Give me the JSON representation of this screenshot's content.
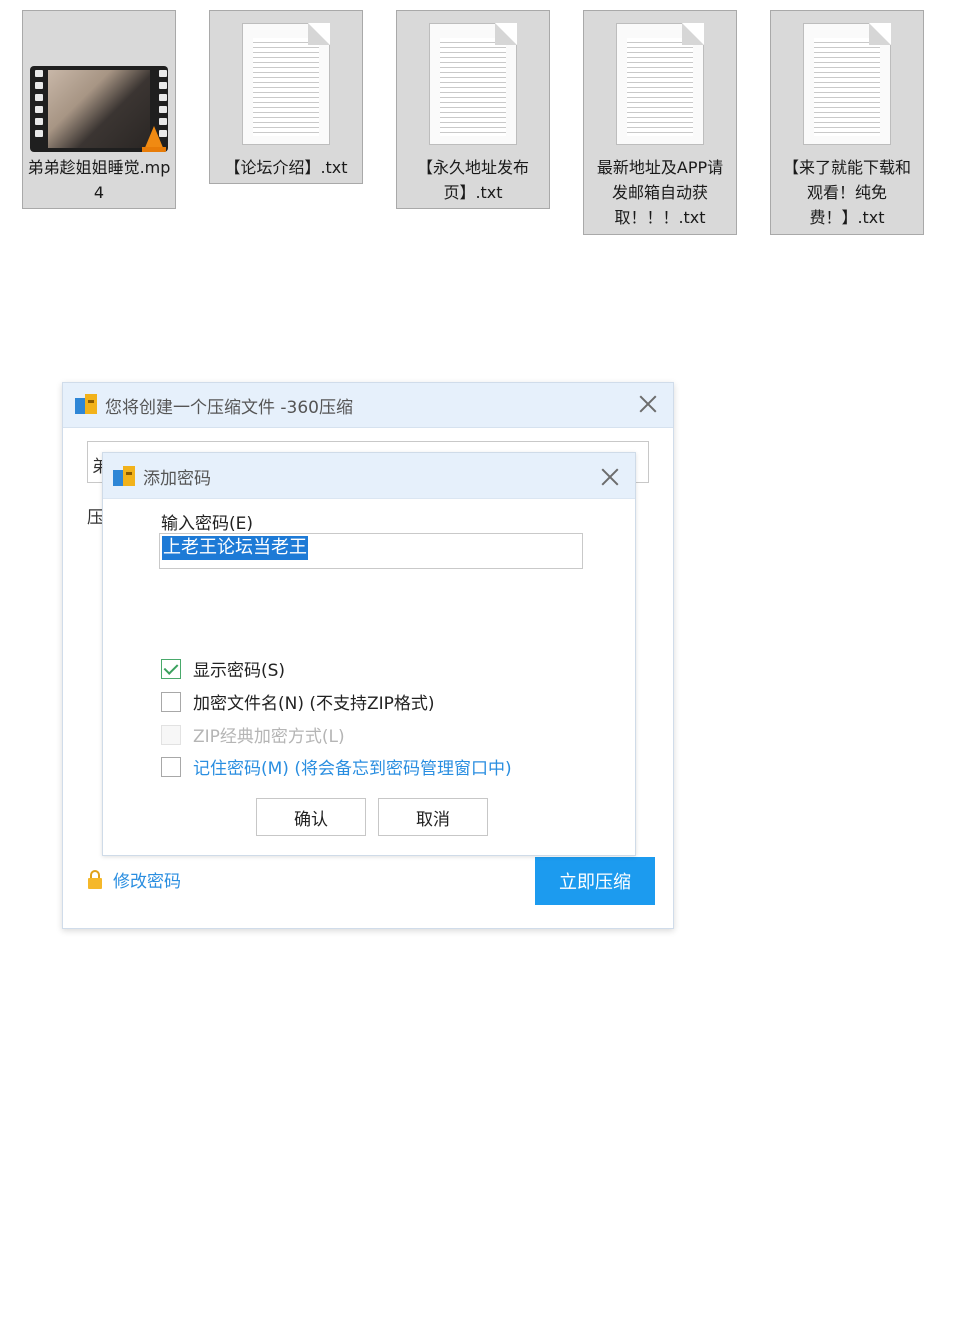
{
  "files": [
    {
      "label": "弟弟趁姐姐睡觉.mp4",
      "icon": "video-file-icon"
    },
    {
      "label": "【论坛介绍】.txt",
      "icon": "text-file-icon"
    },
    {
      "label": "【永久地址发布页】.txt",
      "icon": "text-file-icon"
    },
    {
      "label": "最新地址及APP请发邮箱自动获取！！！.txt",
      "icon": "text-file-icon"
    },
    {
      "label": "【来了就能下载和观看！纯免费！】.txt",
      "icon": "text-file-icon"
    }
  ],
  "compress_dialog": {
    "title": "您将创建一个压缩文件 -360压缩",
    "path_field_partial": "弟",
    "compress_format_partial": "压",
    "change_password_label": "修改密码",
    "compress_now_label": "立即压缩"
  },
  "password_dialog": {
    "title": "添加密码",
    "input_label": "输入密码(E)",
    "password_value": "上老王论坛当老王",
    "options": [
      {
        "label": "显示密码(S)",
        "checked": true,
        "disabled": false
      },
      {
        "label": "加密文件名(N) (不支持ZIP格式)",
        "checked": false,
        "disabled": false
      },
      {
        "label": "ZIP经典加密方式(L)",
        "checked": false,
        "disabled": true
      },
      {
        "label": "记住密码(M) (将会备忘到密码管理窗口中)",
        "checked": false,
        "disabled": false
      }
    ],
    "confirm_label": "确认",
    "cancel_label": "取消"
  },
  "colors": {
    "accent_blue": "#1c9bef",
    "link_blue": "#2a8ee0",
    "titlebar_bg": "#e6f0fb",
    "checkbox_green": "#3aa15e"
  }
}
